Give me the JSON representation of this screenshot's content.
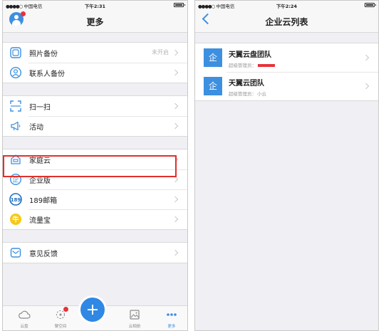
{
  "left_screen": {
    "status": {
      "carrier": "中国电信",
      "time": "下午2:31"
    },
    "title": "更多",
    "groups": [
      [
        {
          "name": "photo-backup",
          "label": "照片备份",
          "detail": "未开启",
          "icon": "photo-backup-icon"
        },
        {
          "name": "contacts-backup",
          "label": "联系人备份",
          "detail": "",
          "icon": "contacts-icon"
        }
      ],
      [
        {
          "name": "scan",
          "label": "扫一扫",
          "detail": "",
          "icon": "scan-icon"
        },
        {
          "name": "activity",
          "label": "活动",
          "detail": "",
          "icon": "megaphone-icon"
        }
      ],
      [
        {
          "name": "family-cloud",
          "label": "家庭云",
          "detail": "",
          "icon": "house-icon"
        },
        {
          "name": "enterprise",
          "label": "企业版",
          "detail": "",
          "icon": "enterprise-icon",
          "glyph": "企"
        },
        {
          "name": "mail-189",
          "label": "189邮箱",
          "detail": "",
          "icon": "mail-189-icon",
          "glyph": "189"
        },
        {
          "name": "data-treasure",
          "label": "流量宝",
          "detail": "",
          "icon": "niu-icon",
          "glyph": "牛"
        }
      ],
      [
        {
          "name": "feedback",
          "label": "意见反馈",
          "detail": "",
          "icon": "feedback-icon"
        }
      ]
    ],
    "tabs": [
      {
        "name": "cloud",
        "label": "云盘",
        "icon": "cloud-icon",
        "active": false,
        "badge": false
      },
      {
        "name": "space",
        "label": "聊空间",
        "icon": "sparkle-icon",
        "active": false,
        "badge": true
      },
      {
        "name": "album",
        "label": "云相册",
        "icon": "picture-icon",
        "active": false,
        "badge": false
      },
      {
        "name": "more",
        "label": "更多",
        "icon": "more-dots-icon",
        "active": true,
        "badge": false
      }
    ],
    "highlight_target": "enterprise"
  },
  "right_screen": {
    "status": {
      "carrier": "中国电信",
      "time": "下午2:24"
    },
    "title": "企业云列表",
    "enterprises": [
      {
        "name": "天翼云盘团队",
        "admin_label": "超级管理员：",
        "admin_value": "",
        "admin_redacted": true,
        "icon_glyph": "企"
      },
      {
        "name": "天翼云团队",
        "admin_label": "超级管理员：",
        "admin_value": "小云",
        "admin_redacted": false,
        "icon_glyph": "企"
      }
    ]
  },
  "colors": {
    "accent": "#3d8fe0",
    "badge": "#e8323c",
    "highlight": "#e0302b",
    "background": "#efeff4"
  }
}
